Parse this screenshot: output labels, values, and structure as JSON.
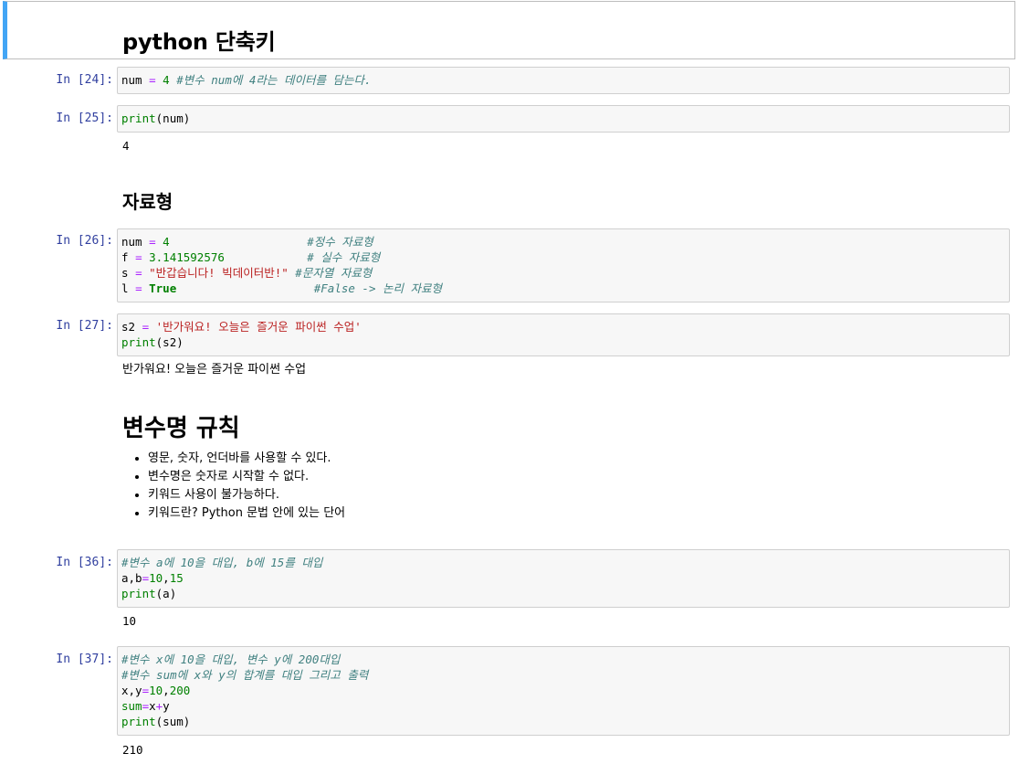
{
  "title": "python 단축키",
  "cells": {
    "c24": {
      "prompt": "In [24]:",
      "code": "num = 4 #변수 num에 4라는 데이터를 담는다."
    },
    "c25": {
      "prompt": "In [25]:",
      "output": "4"
    },
    "heading_types": "자료형",
    "c26": {
      "prompt": "In [26]:"
    },
    "c27": {
      "prompt": "In [27]:",
      "output": "반가워요! 오늘은 즐거운 파이썬 수업"
    },
    "heading_rules": "변수명 규칙",
    "rules": [
      "영문, 숫자, 언더바를 사용할 수 있다.",
      "변수명은 숫자로 시작할 수 없다.",
      "키워드 사용이 불가능하다.",
      "키워드란? Python 문법 안에 있는 단어"
    ],
    "c36": {
      "prompt": "In [36]:",
      "output": "10"
    },
    "c37": {
      "prompt": "In [37]:",
      "output": "210"
    }
  },
  "code_tokens": {
    "c24": {
      "var": "num",
      "eq": "=",
      "val": "4",
      "comment": "#변수 num에 4라는 데이터를 담는다."
    },
    "c25": {
      "fn": "print",
      "args": "(num)"
    },
    "c26": {
      "l1": {
        "var": "num",
        "eq": "=",
        "val": "4",
        "pad": "                    ",
        "comment": "#정수 자료형"
      },
      "l2": {
        "var": "f",
        "eq": "=",
        "val": "3.141592576",
        "pad": "            ",
        "comment": "# 실수 자료형"
      },
      "l3": {
        "var": "s",
        "eq": "=",
        "val": "\"반갑습니다! 빅데이터반!\"",
        "pad": " ",
        "comment": "#문자열 자료형"
      },
      "l4": {
        "var": "l",
        "eq": "=",
        "val": "True",
        "pad": "                    ",
        "comment": "#False -> 논리 자료형"
      }
    },
    "c27": {
      "var": "s2",
      "eq": "=",
      "val": "'반가워요! 오늘은 즐거운 파이썬 수업'",
      "fn": "print",
      "args": "(s2)"
    },
    "c36": {
      "comment": "#변수 a에 10을 대입, b에 15를 대입",
      "lhs": "a,b",
      "eq": "=",
      "v1": "10",
      "comma": ",",
      "v2": "15",
      "fn": "print",
      "args": "(a)"
    },
    "c37": {
      "comment1": "#변수 x에 10을 대입, 변수 y에 200대입",
      "comment2": "#변수 sum에 x와 y의 합계를 대입 그리고 출력",
      "lhs": "x,y",
      "eq": "=",
      "v1": "10",
      "comma": ",",
      "v2": "200",
      "sumvar": "sum",
      "x": "x",
      "plus": "+",
      "y": "y",
      "fn": "print",
      "args": "(sum)"
    }
  },
  "colors": {
    "accent": "#42a5f5",
    "prompt": "#303f9f",
    "keyword": "#008000",
    "string": "#ba2121",
    "comment": "#408080",
    "operator": "#aa22ff"
  }
}
